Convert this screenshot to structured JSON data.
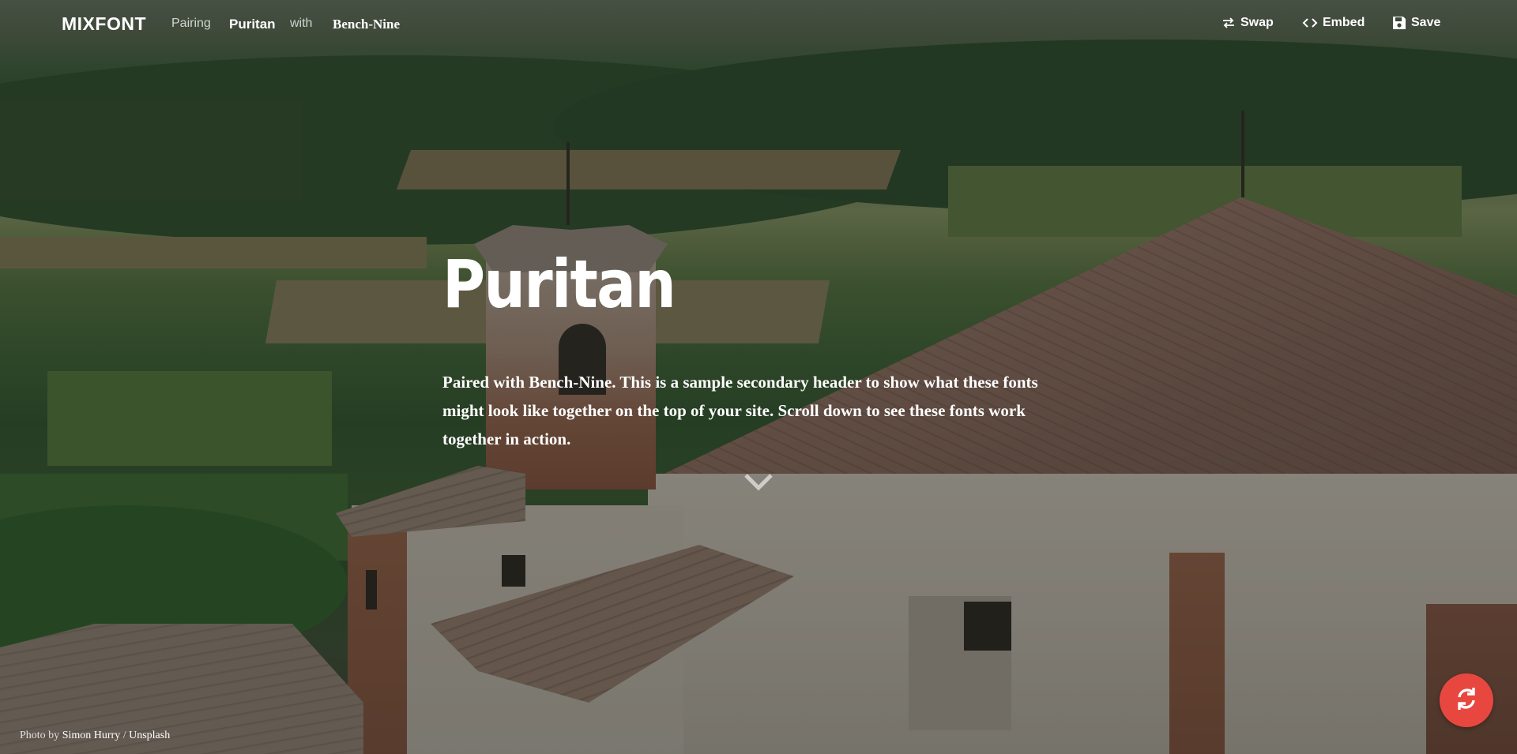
{
  "nav": {
    "logo": "MIXFONT",
    "pairing_label": "Pairing",
    "primary_font": "Puritan",
    "with_label": "with",
    "secondary_font": "Bench-Nine",
    "actions": {
      "swap": "Swap",
      "embed": "Embed",
      "save": "Save"
    }
  },
  "hero": {
    "title": "Puritan",
    "subtitle": "Paired with Bench-Nine. This is a sample secondary header to show what these fonts might look like together on the top of your site. Scroll down to see these fonts work together in action."
  },
  "credit": {
    "prefix": "Photo by",
    "author": "Simon Hurry",
    "separator": "/",
    "source": "Unsplash"
  },
  "icons": {
    "swap": "swap-arrows-icon",
    "embed": "code-brackets-icon",
    "save": "floppy-disk-icon",
    "scroll": "chevron-down-icon",
    "refresh": "refresh-icon"
  },
  "colors": {
    "fab": "#e8473f",
    "text": "#ffffff"
  }
}
